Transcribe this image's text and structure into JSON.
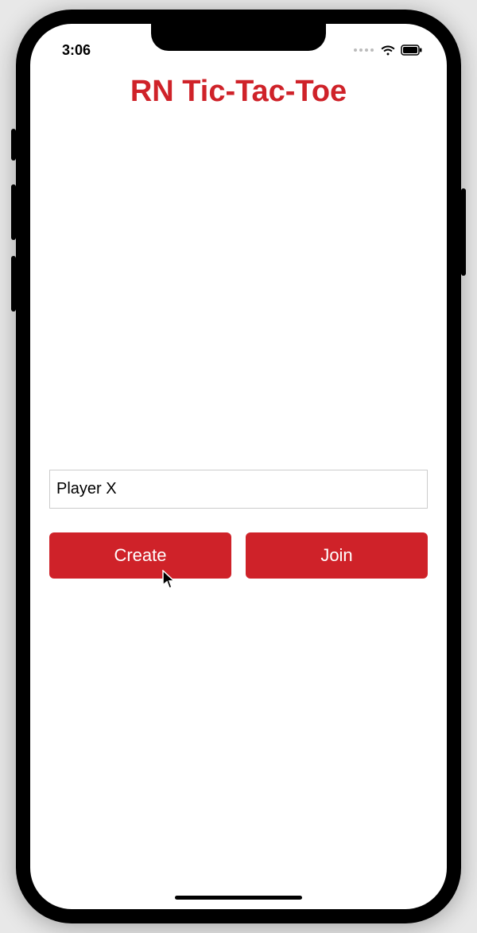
{
  "status": {
    "time": "3:06"
  },
  "app": {
    "title": "RN Tic-Tac-Toe"
  },
  "form": {
    "player_input_value": "Player X"
  },
  "buttons": {
    "create_label": "Create",
    "join_label": "Join"
  },
  "colors": {
    "accent": "#cf2229"
  }
}
